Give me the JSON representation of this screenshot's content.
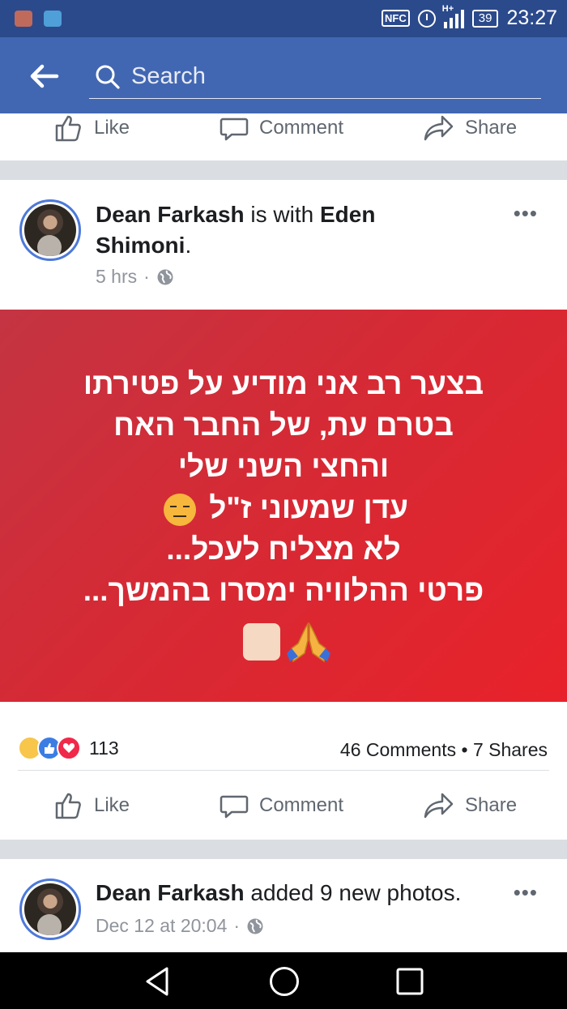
{
  "status_bar": {
    "nfc": "NFC",
    "network": "H+",
    "battery": "39",
    "time": "23:27"
  },
  "nav": {
    "search_placeholder": "Search"
  },
  "top_actions": {
    "like": "Like",
    "comment": "Comment",
    "share": "Share"
  },
  "post": {
    "author": "Dean Farkash",
    "with_text": " is with ",
    "tagged": "Eden Shimoni",
    "tagged_end": ".",
    "time": "5 hrs",
    "separator": "·",
    "more": "•••",
    "banner_lines": [
      "בצער רב אני מודיע על פטירתו",
      "בטרם עת, של החבר האח",
      "והחצי השני שלי",
      "עדן שמעוני ז\"ל",
      "לא מצליח לעכל...",
      "פרטי ההלוויה ימסרו בהמשך..."
    ],
    "reaction_count": "113",
    "comments": "46 Comments",
    "shares": "7 Shares",
    "stats_sep": " • ",
    "like": "Like",
    "comment": "Comment",
    "share": "Share"
  },
  "post2": {
    "author": "Dean Farkash",
    "action": " added 9 new photos.",
    "time": "Dec 12 at 20:04",
    "separator": "·",
    "more": "•••"
  }
}
